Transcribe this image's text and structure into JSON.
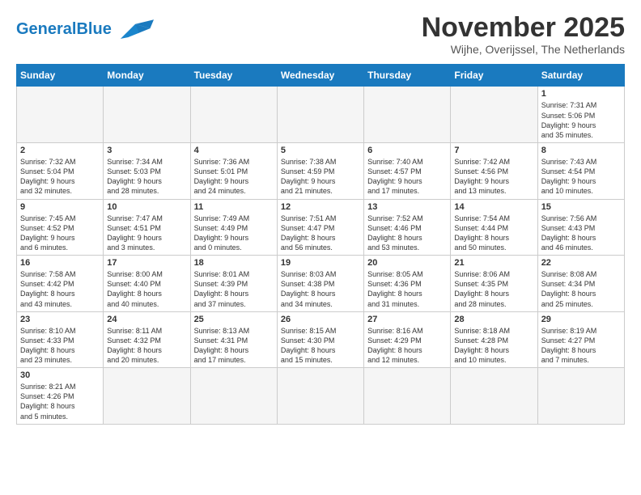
{
  "header": {
    "logo_general": "General",
    "logo_blue": "Blue",
    "month_title": "November 2025",
    "location": "Wijhe, Overijssel, The Netherlands"
  },
  "weekdays": [
    "Sunday",
    "Monday",
    "Tuesday",
    "Wednesday",
    "Thursday",
    "Friday",
    "Saturday"
  ],
  "weeks": [
    [
      {
        "day": "",
        "info": ""
      },
      {
        "day": "",
        "info": ""
      },
      {
        "day": "",
        "info": ""
      },
      {
        "day": "",
        "info": ""
      },
      {
        "day": "",
        "info": ""
      },
      {
        "day": "",
        "info": ""
      },
      {
        "day": "1",
        "info": "Sunrise: 7:31 AM\nSunset: 5:06 PM\nDaylight: 9 hours\nand 35 minutes."
      }
    ],
    [
      {
        "day": "2",
        "info": "Sunrise: 7:32 AM\nSunset: 5:04 PM\nDaylight: 9 hours\nand 32 minutes."
      },
      {
        "day": "3",
        "info": "Sunrise: 7:34 AM\nSunset: 5:03 PM\nDaylight: 9 hours\nand 28 minutes."
      },
      {
        "day": "4",
        "info": "Sunrise: 7:36 AM\nSunset: 5:01 PM\nDaylight: 9 hours\nand 24 minutes."
      },
      {
        "day": "5",
        "info": "Sunrise: 7:38 AM\nSunset: 4:59 PM\nDaylight: 9 hours\nand 21 minutes."
      },
      {
        "day": "6",
        "info": "Sunrise: 7:40 AM\nSunset: 4:57 PM\nDaylight: 9 hours\nand 17 minutes."
      },
      {
        "day": "7",
        "info": "Sunrise: 7:42 AM\nSunset: 4:56 PM\nDaylight: 9 hours\nand 13 minutes."
      },
      {
        "day": "8",
        "info": "Sunrise: 7:43 AM\nSunset: 4:54 PM\nDaylight: 9 hours\nand 10 minutes."
      }
    ],
    [
      {
        "day": "9",
        "info": "Sunrise: 7:45 AM\nSunset: 4:52 PM\nDaylight: 9 hours\nand 6 minutes."
      },
      {
        "day": "10",
        "info": "Sunrise: 7:47 AM\nSunset: 4:51 PM\nDaylight: 9 hours\nand 3 minutes."
      },
      {
        "day": "11",
        "info": "Sunrise: 7:49 AM\nSunset: 4:49 PM\nDaylight: 9 hours\nand 0 minutes."
      },
      {
        "day": "12",
        "info": "Sunrise: 7:51 AM\nSunset: 4:47 PM\nDaylight: 8 hours\nand 56 minutes."
      },
      {
        "day": "13",
        "info": "Sunrise: 7:52 AM\nSunset: 4:46 PM\nDaylight: 8 hours\nand 53 minutes."
      },
      {
        "day": "14",
        "info": "Sunrise: 7:54 AM\nSunset: 4:44 PM\nDaylight: 8 hours\nand 50 minutes."
      },
      {
        "day": "15",
        "info": "Sunrise: 7:56 AM\nSunset: 4:43 PM\nDaylight: 8 hours\nand 46 minutes."
      }
    ],
    [
      {
        "day": "16",
        "info": "Sunrise: 7:58 AM\nSunset: 4:42 PM\nDaylight: 8 hours\nand 43 minutes."
      },
      {
        "day": "17",
        "info": "Sunrise: 8:00 AM\nSunset: 4:40 PM\nDaylight: 8 hours\nand 40 minutes."
      },
      {
        "day": "18",
        "info": "Sunrise: 8:01 AM\nSunset: 4:39 PM\nDaylight: 8 hours\nand 37 minutes."
      },
      {
        "day": "19",
        "info": "Sunrise: 8:03 AM\nSunset: 4:38 PM\nDaylight: 8 hours\nand 34 minutes."
      },
      {
        "day": "20",
        "info": "Sunrise: 8:05 AM\nSunset: 4:36 PM\nDaylight: 8 hours\nand 31 minutes."
      },
      {
        "day": "21",
        "info": "Sunrise: 8:06 AM\nSunset: 4:35 PM\nDaylight: 8 hours\nand 28 minutes."
      },
      {
        "day": "22",
        "info": "Sunrise: 8:08 AM\nSunset: 4:34 PM\nDaylight: 8 hours\nand 25 minutes."
      }
    ],
    [
      {
        "day": "23",
        "info": "Sunrise: 8:10 AM\nSunset: 4:33 PM\nDaylight: 8 hours\nand 23 minutes."
      },
      {
        "day": "24",
        "info": "Sunrise: 8:11 AM\nSunset: 4:32 PM\nDaylight: 8 hours\nand 20 minutes."
      },
      {
        "day": "25",
        "info": "Sunrise: 8:13 AM\nSunset: 4:31 PM\nDaylight: 8 hours\nand 17 minutes."
      },
      {
        "day": "26",
        "info": "Sunrise: 8:15 AM\nSunset: 4:30 PM\nDaylight: 8 hours\nand 15 minutes."
      },
      {
        "day": "27",
        "info": "Sunrise: 8:16 AM\nSunset: 4:29 PM\nDaylight: 8 hours\nand 12 minutes."
      },
      {
        "day": "28",
        "info": "Sunrise: 8:18 AM\nSunset: 4:28 PM\nDaylight: 8 hours\nand 10 minutes."
      },
      {
        "day": "29",
        "info": "Sunrise: 8:19 AM\nSunset: 4:27 PM\nDaylight: 8 hours\nand 7 minutes."
      }
    ],
    [
      {
        "day": "30",
        "info": "Sunrise: 8:21 AM\nSunset: 4:26 PM\nDaylight: 8 hours\nand 5 minutes."
      },
      {
        "day": "",
        "info": ""
      },
      {
        "day": "",
        "info": ""
      },
      {
        "day": "",
        "info": ""
      },
      {
        "day": "",
        "info": ""
      },
      {
        "day": "",
        "info": ""
      },
      {
        "day": "",
        "info": ""
      }
    ]
  ]
}
